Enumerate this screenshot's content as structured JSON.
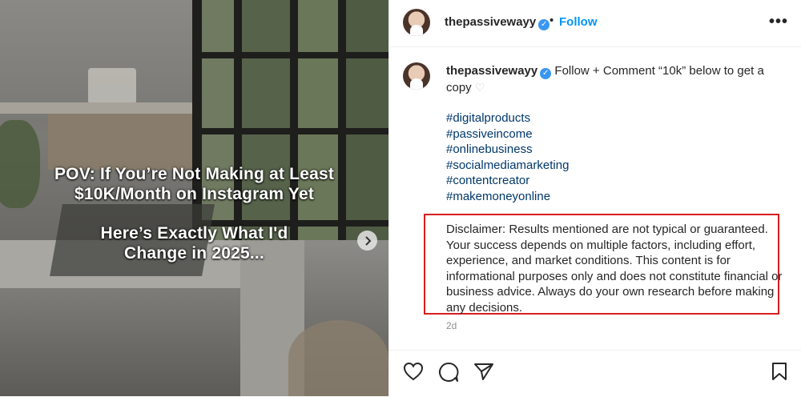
{
  "media": {
    "overlay_line1": "POV: If You’re Not Making at Least",
    "overlay_line2": "$10K/Month on Instagram Yet",
    "overlay_line3": "Here’s Exactly What I'd",
    "overlay_line4": "Change in 2025...",
    "next_icon": "chevron-right-icon"
  },
  "header": {
    "username": "thepassivewayy",
    "verified_glyph": "✓",
    "separator": "•",
    "follow_label": "Follow",
    "more_label": "•••"
  },
  "caption": {
    "username": "thepassivewayy",
    "verified_glyph": "✓",
    "text": " Follow + Comment “10k” below to get a copy ",
    "heart": "♡",
    "hashtags": [
      "#digitalproducts",
      "#passiveincome",
      "#onlinebusiness",
      "#socialmediamarketing",
      "#contentcreator",
      "#makemoneyonline"
    ],
    "disclaimer": "Disclaimer: Results mentioned are not typical or guaranteed. Your success depends on multiple factors, including effort, experience, and market conditions. This content is for informational purposes only and does not constitute financial or business advice. Always do your own research before making any decisions.",
    "timestamp": "2d"
  },
  "actions": {
    "icons": [
      "heart-icon",
      "comment-icon",
      "share-icon",
      "bookmark-icon"
    ]
  },
  "colors": {
    "link": "#0095f6",
    "hashtag": "#00376b",
    "highlight_border": "#d81e1e",
    "verified": "#3897f0"
  }
}
